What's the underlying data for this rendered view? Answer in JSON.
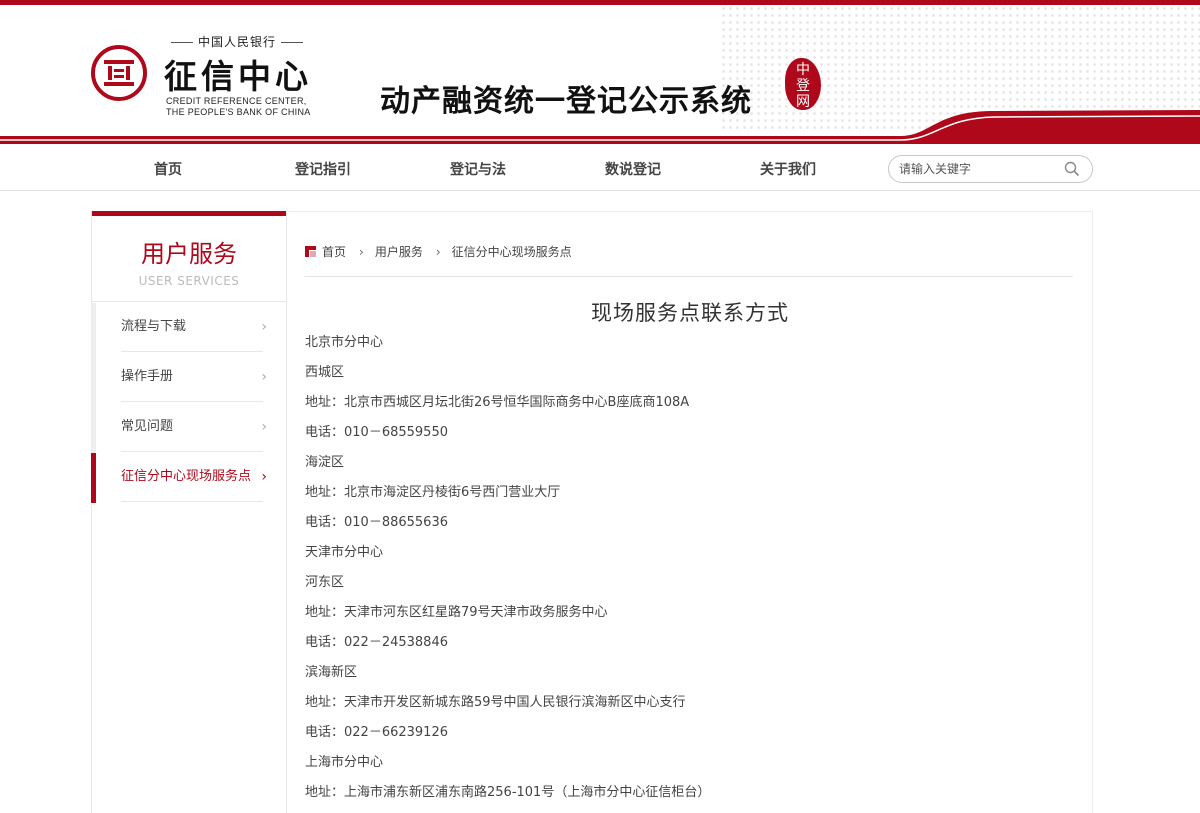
{
  "header": {
    "org_name": "中国人民银行",
    "logo_cn": "征信中心",
    "logo_en_line1": "CREDIT REFERENCE CENTER,",
    "logo_en_line2": "THE PEOPLE'S BANK OF CHINA",
    "system_title": "动产融资统一登记公示系统",
    "seal_text": "中登网",
    "brand_color": "#b0081b"
  },
  "nav": {
    "items": [
      "首页",
      "登记指引",
      "登记与法",
      "数说登记",
      "关于我们"
    ],
    "search_placeholder": "请输入关键字"
  },
  "sidebar": {
    "title": "用户服务",
    "subtitle": "USER SERVICES",
    "items": [
      {
        "label": "流程与下载",
        "active": false
      },
      {
        "label": "操作手册",
        "active": false
      },
      {
        "label": "常见问题",
        "active": false
      },
      {
        "label": "征信分中心现场服务点",
        "active": true
      }
    ]
  },
  "breadcrumb": [
    "首页",
    "用户服务",
    "征信分中心现场服务点"
  ],
  "page_title": "现场服务点联系方式",
  "content_lines": [
    "北京市分中心",
    "西城区",
    "地址：北京市西城区月坛北街26号恒华国际商务中心B座底商108A",
    "电话：010－68559550",
    "海淀区",
    "地址：北京市海淀区丹棱街6号西门营业大厅",
    "电话：010－88655636",
    "天津市分中心",
    "河东区",
    "地址：天津市河东区红星路79号天津市政务服务中心",
    "电话：022－24538846",
    "滨海新区",
    "地址：天津市开发区新城东路59号中国人民银行滨海新区中心支行",
    "电话：022－66239126",
    "上海市分中心",
    "地址：上海市浦东新区浦东南路256-101号（上海市分中心征信柜台）"
  ]
}
